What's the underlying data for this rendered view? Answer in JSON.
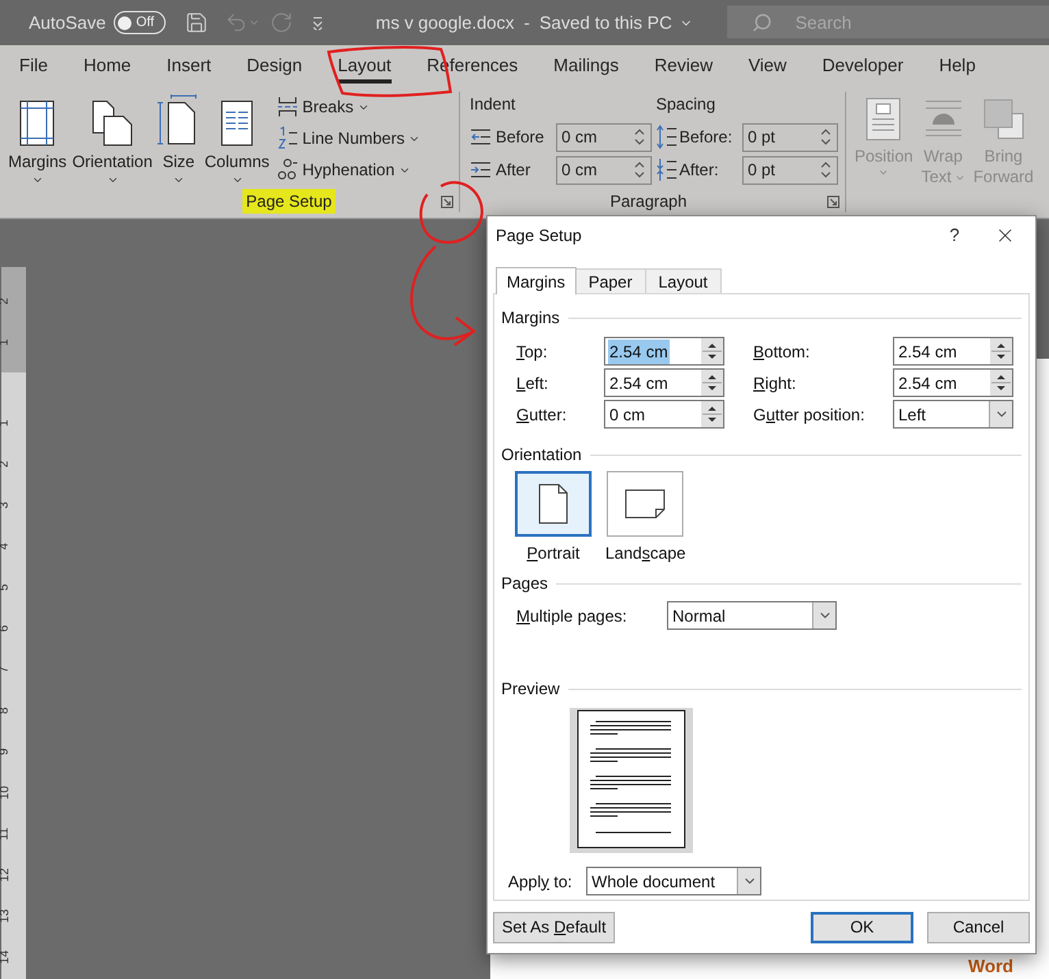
{
  "title_bar": {
    "autosave_label": "AutoSave",
    "autosave_toggle": {
      "on": false,
      "label": "Off"
    },
    "document_title": "ms v google.docx",
    "separator": "-",
    "save_status": "Saved to this PC",
    "search": {
      "placeholder": "Search"
    }
  },
  "ribbon_tabs": [
    {
      "label": "File",
      "selected": false
    },
    {
      "label": "Home",
      "selected": false
    },
    {
      "label": "Insert",
      "selected": false
    },
    {
      "label": "Design",
      "selected": false
    },
    {
      "label": "Layout",
      "selected": true
    },
    {
      "label": "References",
      "selected": false
    },
    {
      "label": "Mailings",
      "selected": false
    },
    {
      "label": "Review",
      "selected": false
    },
    {
      "label": "View",
      "selected": false
    },
    {
      "label": "Developer",
      "selected": false
    },
    {
      "label": "Help",
      "selected": false
    }
  ],
  "page_setup_group": {
    "label": "Page Setup",
    "highlighted": true,
    "buttons": [
      "Margins",
      "Orientation",
      "Size",
      "Columns"
    ],
    "small_buttons": [
      "Breaks",
      "Line Numbers",
      "Hyphenation"
    ]
  },
  "paragraph_group": {
    "label": "Paragraph",
    "indent_label": "Indent",
    "spacing_label": "Spacing",
    "indent": [
      {
        "label": "Before",
        "value": "0 cm"
      },
      {
        "label": "After",
        "value": "0 cm"
      }
    ],
    "spacing": [
      {
        "label": "Before:",
        "value": "0 pt"
      },
      {
        "label": "After:",
        "value": "0 pt"
      }
    ]
  },
  "arrange_group": {
    "buttons": [
      {
        "lines": [
          "Position"
        ],
        "dropdown": true,
        "disabled": true
      },
      {
        "lines": [
          "Wrap",
          "Text"
        ],
        "dropdown": true,
        "disabled": true
      },
      {
        "lines": [
          "Bring",
          "Forward"
        ],
        "dropdown": false,
        "disabled": true
      }
    ]
  },
  "ruler": {
    "top_marks": [
      "2",
      "1"
    ],
    "body_marks": [
      "1",
      "2",
      "3",
      "4",
      "5",
      "6",
      "7",
      "8",
      "9",
      "10",
      "11",
      "12",
      "13",
      "14"
    ]
  },
  "document": {
    "visible_text": "Word"
  },
  "dialog": {
    "title": "Page Setup",
    "help": "?",
    "tabs": [
      {
        "label": "Margins",
        "selected": true
      },
      {
        "label": "Paper",
        "selected": false
      },
      {
        "label": "Layout",
        "selected": false
      }
    ],
    "margins_heading": "Margins",
    "margin_fields": [
      {
        "label": {
          "key": "T",
          "after": "op:"
        },
        "value": "2.54 cm",
        "kind": "spin",
        "text_selected": true
      },
      {
        "label": {
          "key": "B",
          "after": "ottom:"
        },
        "value": "2.54 cm",
        "kind": "spin",
        "text_selected": false
      },
      {
        "label": {
          "key": "L",
          "after": "eft:"
        },
        "value": "2.54 cm",
        "kind": "spin",
        "text_selected": false
      },
      {
        "label": {
          "key": "R",
          "after": "ight:"
        },
        "value": "2.54 cm",
        "kind": "spin",
        "text_selected": false
      },
      {
        "label": {
          "key": "G",
          "after": "utter:"
        },
        "value": "0 cm",
        "kind": "spin",
        "text_selected": false
      },
      {
        "label": {
          "before": "G",
          "key": "u",
          "after": "tter position:"
        },
        "value": "Left",
        "kind": "dropdown",
        "text_selected": false
      }
    ],
    "orientation_heading": "Orientation",
    "orientations": [
      {
        "label": {
          "key": "P",
          "after": "ortrait"
        },
        "selected": true
      },
      {
        "label": {
          "before": "Land",
          "key": "s",
          "after": "cape"
        },
        "selected": false
      }
    ],
    "pages_heading": "Pages",
    "multiple_pages": {
      "label": {
        "key": "M",
        "after": "ultiple pages:"
      },
      "value": "Normal"
    },
    "preview_heading": "Preview",
    "apply_to": {
      "label": {
        "before": "Appl",
        "key": "y",
        "after": " to:"
      },
      "value": "Whole document"
    },
    "buttons": [
      {
        "label": {
          "before": "Set As ",
          "key": "D",
          "after": "efault"
        },
        "default": false
      },
      {
        "label": {
          "before": "OK"
        },
        "default": true
      },
      {
        "label": {
          "before": "Cancel"
        },
        "default": false
      }
    ]
  }
}
